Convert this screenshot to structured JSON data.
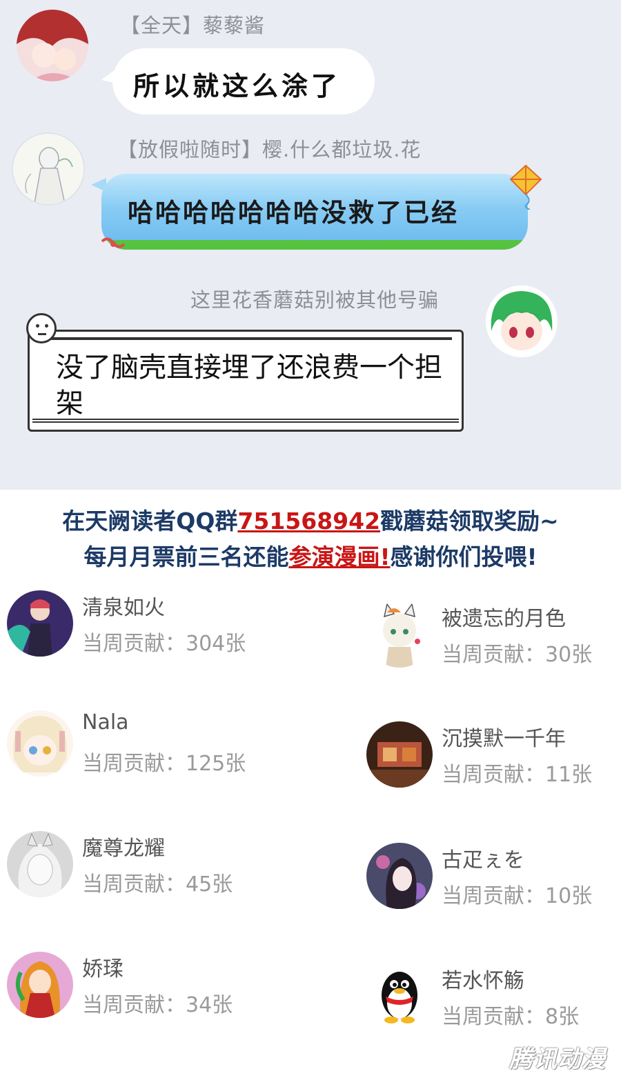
{
  "chat": {
    "messages": [
      {
        "sender": "【全天】藜藜酱",
        "text": "所以就这么涂了"
      },
      {
        "sender": "【放假啦随时】樱.什么都垃圾.花",
        "text": "哈哈哈哈哈哈哈没救了已经"
      },
      {
        "sender": "这里花香蘑菇别被其他号骗",
        "text": "没了脑壳直接埋了还浪费一个担架"
      }
    ]
  },
  "notice": {
    "line1_a": "在天阙读者QQ群",
    "line1_num": "751568942",
    "line1_b": "戳蘑菇领取奖励~",
    "line2_a": "每月月票前三名还能",
    "line2_red": "参演漫画!",
    "line2_b": "感谢你们投喂!"
  },
  "contributors": [
    {
      "name": "清泉如火",
      "contribution": "当周贡献：304张"
    },
    {
      "name": "被遗忘的月色",
      "contribution": "当周贡献：30张"
    },
    {
      "name": "Nala",
      "contribution": "当周贡献：125张"
    },
    {
      "name": "沉摸默一千年",
      "contribution": "当周贡献：11张"
    },
    {
      "name": "魔尊龙耀",
      "contribution": "当周贡献：45张"
    },
    {
      "name": "古疋ぇを",
      "contribution": "当周贡献：10张"
    },
    {
      "name": "娇瑈",
      "contribution": "当周贡献：34张"
    },
    {
      "name": "若水怀觞",
      "contribution": "当周贡献：8张"
    }
  ],
  "watermark": "腾讯动漫"
}
